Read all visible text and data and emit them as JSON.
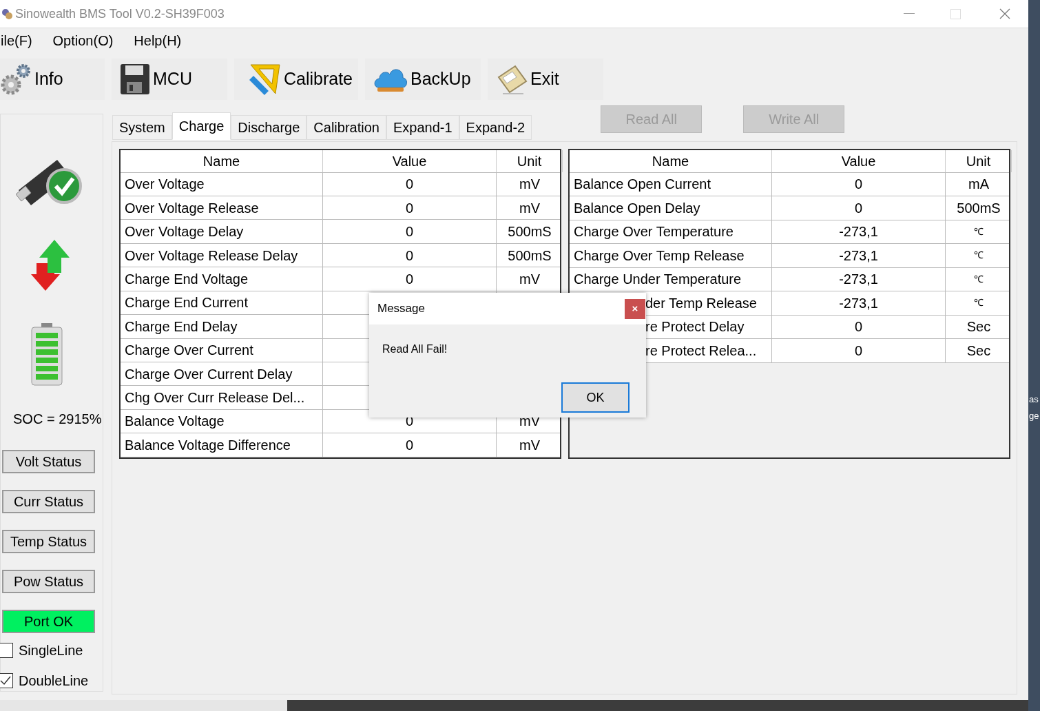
{
  "window": {
    "title": "Sinowealth BMS Tool V0.2-SH39F003"
  },
  "menu": [
    "ile(F)",
    "Option(O)",
    "Help(H)"
  ],
  "toolbar": [
    {
      "label": "Info",
      "kind": "gear"
    },
    {
      "label": "MCU",
      "kind": "floppy"
    },
    {
      "label": "Calibrate",
      "kind": "ruler"
    },
    {
      "label": "BackUp",
      "kind": "cloud"
    },
    {
      "label": "Exit",
      "kind": "exit"
    }
  ],
  "side": {
    "soc": "SOC = 2915%",
    "buttons": [
      "Volt Status",
      "Curr Status",
      "Temp Status",
      "Pow Status"
    ],
    "port": {
      "label": "Port OK",
      "ok": true
    },
    "options": [
      {
        "label": "SingleLine",
        "checked": false
      },
      {
        "label": "DoubleLine",
        "checked": true
      }
    ]
  },
  "tabs": [
    {
      "label": "System",
      "selected": false
    },
    {
      "label": "Charge",
      "selected": true
    },
    {
      "label": "Discharge",
      "selected": false
    },
    {
      "label": "Calibration",
      "selected": false
    },
    {
      "label": "Expand-1",
      "selected": false
    },
    {
      "label": "Expand-2",
      "selected": false
    }
  ],
  "actions": [
    {
      "label": "Read All",
      "disabled": true
    },
    {
      "label": "Write All",
      "disabled": true
    }
  ],
  "tables": [
    {
      "columns": [
        "Name",
        "Value",
        "Unit"
      ],
      "rows": [
        {
          "name": "Over Voltage",
          "value": "0",
          "unit": "mV"
        },
        {
          "name": "Over Voltage Release",
          "value": "0",
          "unit": "mV"
        },
        {
          "name": "Over Voltage Delay",
          "value": "0",
          "unit": "500mS"
        },
        {
          "name": "Over Voltage Release Delay",
          "value": "0",
          "unit": "500mS"
        },
        {
          "name": "Charge End Voltage",
          "value": "0",
          "unit": "mV"
        },
        {
          "name": "Charge End Current"
        },
        {
          "name": "Charge End Delay"
        },
        {
          "name": "Charge Over Current"
        },
        {
          "name": "Charge Over Current Delay"
        },
        {
          "name": "Chg Over Curr Release Del..."
        },
        {
          "name": "Balance Voltage",
          "value": "0",
          "unit": "mV"
        },
        {
          "name": "Balance Voltage Difference",
          "value": "0",
          "unit": "mV"
        }
      ]
    },
    {
      "columns": [
        "Name",
        "Value",
        "Unit"
      ],
      "rows": [
        {
          "name": "Balance Open Current",
          "value": "0",
          "unit": "mA"
        },
        {
          "name": "Balance Open Delay",
          "value": "0",
          "unit": "500mS"
        },
        {
          "name": "Charge Over Temperature",
          "value": "-273,1",
          "unit": "℃"
        },
        {
          "name": "Charge Over Temp Release",
          "value": "-273,1",
          "unit": "℃"
        },
        {
          "name": "Charge Under Temperature",
          "value": "-273,1",
          "unit": "℃"
        },
        {
          "name": "der Temp Release",
          "value": "-273,1",
          "unit": "℃",
          "covered": true
        },
        {
          "name": "re Protect Delay",
          "value": "0",
          "unit": "Sec",
          "covered": true
        },
        {
          "name": "re Protect Relea...",
          "value": "0",
          "unit": "Sec",
          "covered": true
        }
      ]
    }
  ],
  "dialog": {
    "title": "Message",
    "close": "×",
    "message": "Read All Fail!",
    "button": "OK"
  },
  "desktop": {
    "texts": [
      "as",
      "ge"
    ]
  }
}
